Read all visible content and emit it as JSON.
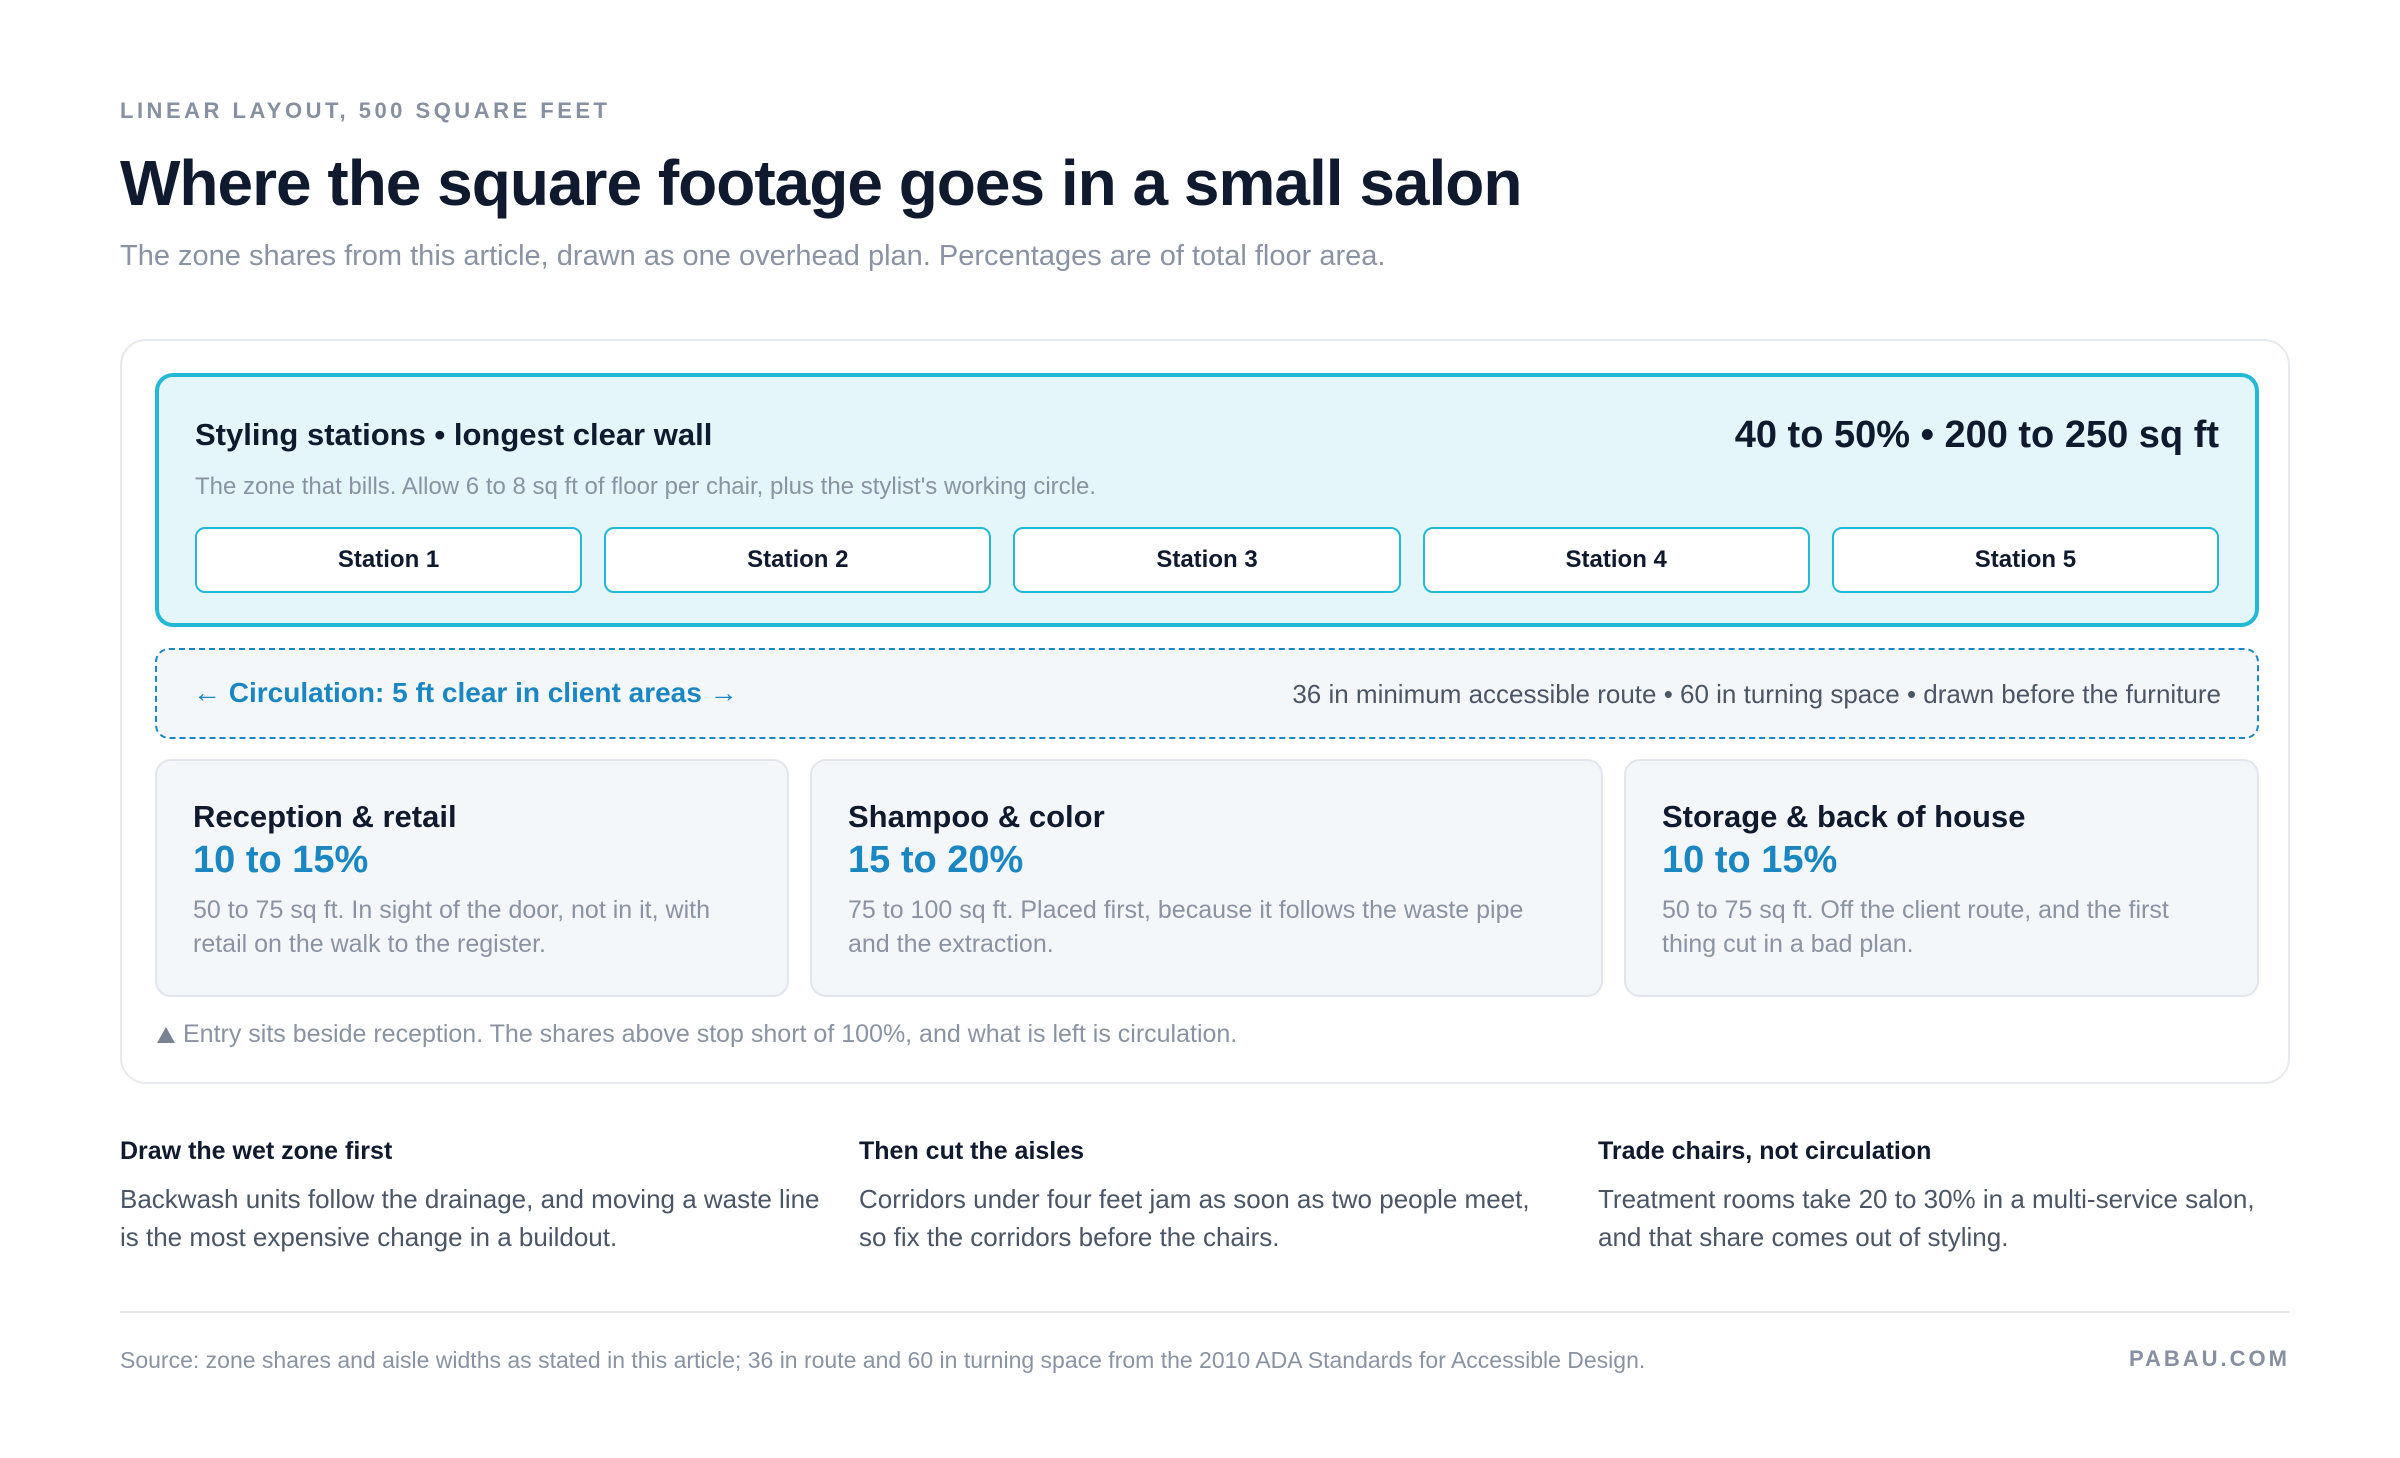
{
  "header": {
    "eyebrow": "LINEAR LAYOUT, 500 SQUARE FEET",
    "title": "Where the square footage goes in a small salon",
    "subtitle": "The zone shares from this article, drawn as one overhead plan. Percentages are of total floor area."
  },
  "plan": {
    "styling": {
      "name": "Styling stations • longest clear wall",
      "share": "40 to 50% • 200 to 250 sq ft",
      "note": "The zone that bills. Allow 6 to 8 sq ft of floor per chair, plus the stylist's working circle.",
      "stations": [
        "Station 1",
        "Station 2",
        "Station 3",
        "Station 4",
        "Station 5"
      ]
    },
    "circulation": {
      "label": "← Circulation: 5 ft clear in client areas →",
      "note": "36 in minimum accessible route • 60 in turning space • drawn before the furniture"
    },
    "zones": [
      {
        "name": "Reception & retail",
        "share": "10 to 15%",
        "desc": "50 to 75 sq ft. In sight of the door, not in it, with retail on the walk to the register."
      },
      {
        "name": "Shampoo & color",
        "share": "15 to 20%",
        "desc": "75 to 100 sq ft. Placed first, because it follows the waste pipe and the extraction."
      },
      {
        "name": "Storage & back of house",
        "share": "10 to 15%",
        "desc": "50 to 75 sq ft. Off the client route, and the first thing cut in a bad plan."
      }
    ],
    "entry_note": "Entry sits beside reception. The shares above stop short of 100%, and what is left is circulation."
  },
  "notes": [
    {
      "heading": "Draw the wet zone first",
      "body": "Backwash units follow the drainage, and moving a waste line is the most expensive change in a buildout."
    },
    {
      "heading": "Then cut the aisles",
      "body": "Corridors under four feet jam as soon as two people meet, so fix the corridors before the chairs."
    },
    {
      "heading": "Trade chairs, not circulation",
      "body": "Treatment rooms take 20 to 30% in a multi-service salon, and that share comes out of styling."
    }
  ],
  "footer": {
    "source": "Source: zone shares and aisle widths as stated in this article; 36 in route and 60 in turning space from the 2010 ADA Standards for Accessible Design.",
    "brand": "PABAU.COM"
  },
  "colors": {
    "accent_cyan": "#22b8d6",
    "accent_blue": "#1a86c2",
    "styling_fill": "#e4f6fa",
    "zone_fill": "#f4f7fa",
    "ink": "#0f1a2e",
    "muted": "#8a93a3"
  }
}
